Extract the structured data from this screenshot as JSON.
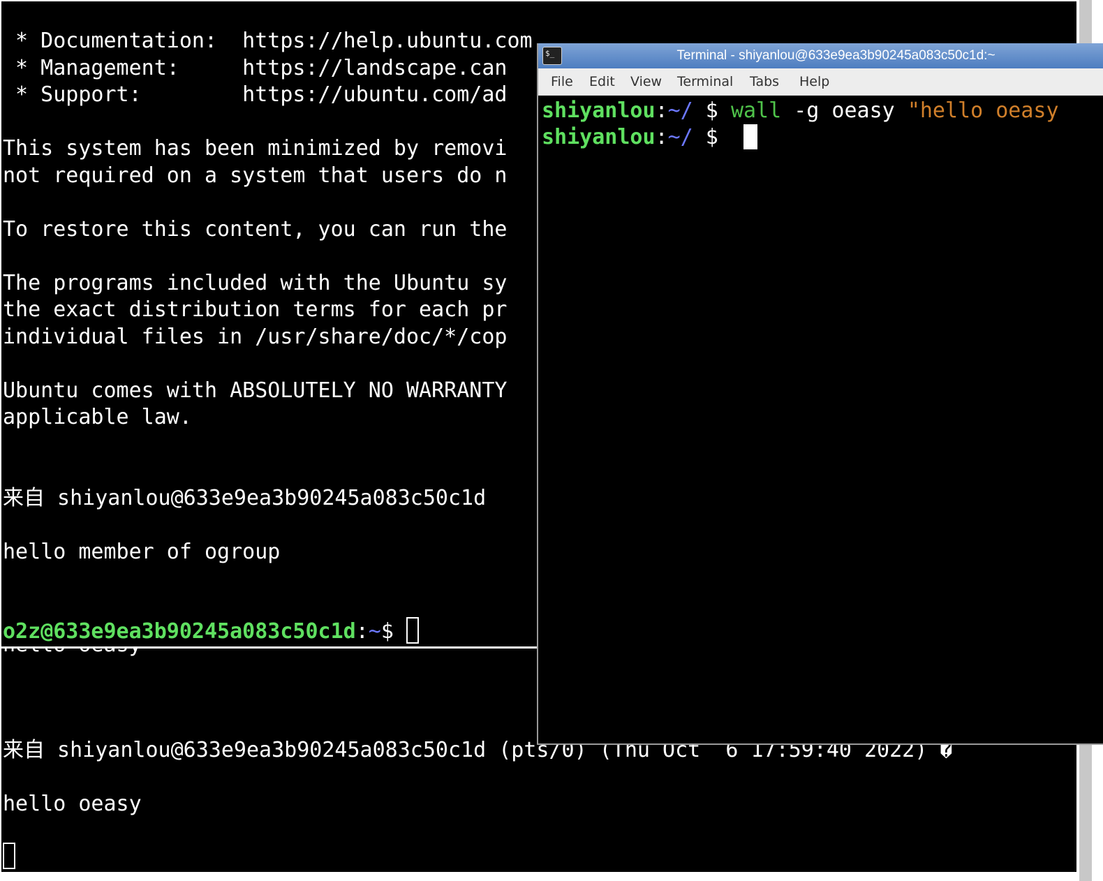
{
  "background_terminal": {
    "top_lines": [
      " * Documentation:  https://help.ubuntu.com",
      " * Management:     https://landscape.can",
      " * Support:        https://ubuntu.com/ad",
      "",
      "This system has been minimized by removi",
      "not required on a system that users do n",
      "",
      "To restore this content, you can run the",
      "",
      "The programs included with the Ubuntu sy",
      "the exact distribution terms for each pr",
      "individual files in /usr/share/doc/*/cop",
      "",
      "Ubuntu comes with ABSOLUTELY NO WARRANTY",
      "applicable law.",
      "",
      "",
      "来自 shiyanlou@633e9ea3b90245a083c50c1d",
      "",
      "hello member of ogroup"
    ],
    "prompt": {
      "user_host": "o2z@633e9ea3b90245a083c50c1d",
      "colon": ":",
      "path": "~",
      "symbol": "$ "
    },
    "bottom_partial": "hello oeasy",
    "bottom_broadcast_header": "来自 shiyanlou@633e9ea3b90245a083c50c1d (pts/0) (Thu Oct  6 17:59:40 2022) �",
    "bottom_message": "hello oeasy"
  },
  "terminal_window": {
    "title": "Terminal - shiyanlou@633e9ea3b90245a083c50c1d:~",
    "icon": "terminal-app-icon",
    "icon_glyph": "$_",
    "menu": [
      "File",
      "Edit",
      "View",
      "Terminal",
      "Tabs",
      "Help"
    ],
    "line1": {
      "user": "shiyanlou",
      "colon": ":",
      "path": "~/",
      "symbol": " $ ",
      "command": "wall",
      "args": " -g oeasy ",
      "string": "\"hello oeasy"
    },
    "line2": {
      "user": "shiyanlou",
      "colon": ":",
      "path": "~/",
      "symbol": " $  "
    }
  },
  "colors": {
    "prompt_user": "#5fe060",
    "prompt_path": "#6c78ff",
    "command": "#4fc34a",
    "string": "#d07f2a",
    "titlebar": "#5b88c8"
  }
}
